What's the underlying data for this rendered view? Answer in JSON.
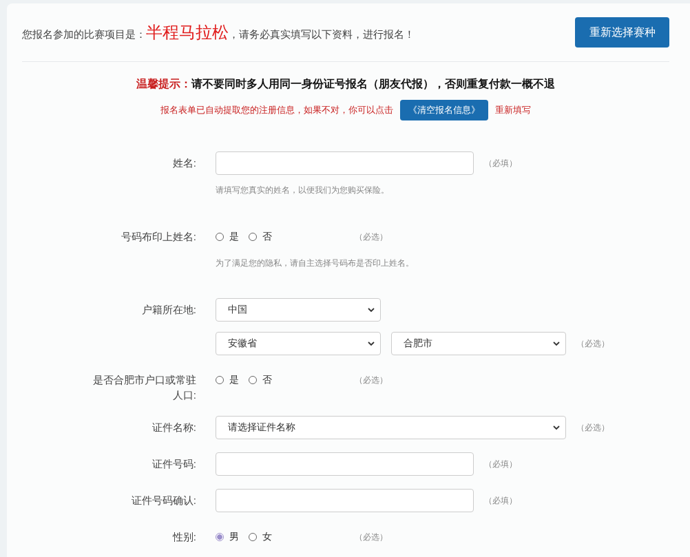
{
  "header": {
    "intro_prefix": "您报名参加的比赛项目是：",
    "event": "半程马拉松",
    "intro_suffix": "，请务必真实填写以下资料，进行报名！",
    "change_button": "重新选择赛种"
  },
  "notice": {
    "label": "温馨提示：",
    "text": "请不要同时多人用同一身份证号报名（朋友代报），否则重复付款一概不退"
  },
  "autofill": {
    "text": "报名表单已自动提取您的注册信息，如果不对，你可以点击",
    "button": "《清空报名信息》",
    "suffix": "重新填写"
  },
  "fields": [
    {
      "kind": "text",
      "label": "姓名:",
      "note": "（必填）",
      "hint": "请填写您真实的姓名，以便我们为您购买保险。"
    },
    {
      "kind": "radio",
      "label": "号码布印上姓名:",
      "options": [
        {
          "label": "是",
          "selected": false
        },
        {
          "label": "否",
          "selected": false
        }
      ],
      "note": "（必选）",
      "hint": "为了满足您的隐私，请自主选择号码布是否印上姓名。"
    },
    {
      "kind": "select-group",
      "label": "户籍所在地:",
      "lines": [
        [
          {
            "value": "中国"
          }
        ],
        [
          {
            "value": "安徽省"
          },
          {
            "value": "合肥市"
          }
        ]
      ],
      "note": "（必选）"
    },
    {
      "kind": "radio",
      "label": "是否合肥市户口或常驻人口:",
      "options": [
        {
          "label": "是",
          "selected": false
        },
        {
          "label": "否",
          "selected": false
        }
      ],
      "note": "（必选）"
    },
    {
      "kind": "select",
      "label": "证件名称:",
      "value": "请选择证件名称",
      "note": "（必选）"
    },
    {
      "kind": "text",
      "label": "证件号码:",
      "note": "（必填）"
    },
    {
      "kind": "text",
      "label": "证件号码确认:",
      "note": "（必填）"
    },
    {
      "kind": "radio",
      "label": "性别:",
      "options": [
        {
          "label": "男",
          "selected": true
        },
        {
          "label": "女",
          "selected": false
        }
      ],
      "note": "（必选）"
    }
  ]
}
